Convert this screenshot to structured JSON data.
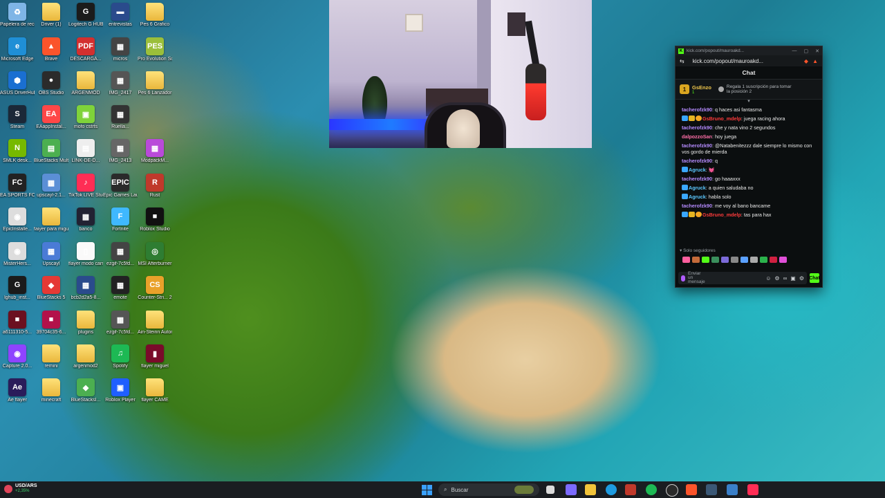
{
  "desktop": {
    "icons": [
      {
        "label": "Papelera de reciclaje",
        "glyph": "♻",
        "color": "#7fb5e6"
      },
      {
        "label": "Driver (1)",
        "glyph": "",
        "color": "folder"
      },
      {
        "label": "Logitech G HUB",
        "glyph": "G",
        "color": "#1b1b1b"
      },
      {
        "label": "entrevistas",
        "glyph": "▬",
        "color": "#2a4b8c"
      },
      {
        "label": "Pes 6 Grafico",
        "glyph": "",
        "color": "folder"
      },
      {
        "label": "Microsoft Edge",
        "glyph": "e",
        "color": "#1f8fd6"
      },
      {
        "label": "Brave",
        "glyph": "▲",
        "color": "#fb542b"
      },
      {
        "label": "DESCARGA...",
        "glyph": "PDF",
        "color": "#d32f2f"
      },
      {
        "label": "micros",
        "glyph": "▦",
        "color": "#444"
      },
      {
        "label": "Pro Evolution Soccer 6",
        "glyph": "PES",
        "color": "#9bbf3a"
      },
      {
        "label": "ASUS DriverHub",
        "glyph": "⬢",
        "color": "#1a6fd1"
      },
      {
        "label": "OBS Studio",
        "glyph": "●",
        "color": "#2b2b2b"
      },
      {
        "label": "ARGENMOD",
        "glyph": "",
        "color": "folder"
      },
      {
        "label": "IMG_2417",
        "glyph": "▦",
        "color": "#555"
      },
      {
        "label": "Pes 6 Lanzador",
        "glyph": "",
        "color": "folder"
      },
      {
        "label": "Steam",
        "glyph": "S",
        "color": "#1b2838"
      },
      {
        "label": "EAappInstal...",
        "glyph": "EA",
        "color": "#ff4747"
      },
      {
        "label": "mofo cstrts",
        "glyph": "▣",
        "color": "#7fd33a"
      },
      {
        "label": "Ruella...",
        "glyph": "▦",
        "color": "#333"
      },
      {
        "label": "",
        "glyph": "",
        "color": "none"
      },
      {
        "label": "SMLK desk...",
        "glyph": "N",
        "color": "#76b900"
      },
      {
        "label": "BlueStacks Multi-Insta...",
        "glyph": "▤",
        "color": "#4caf50"
      },
      {
        "label": "LINK-DE-D...",
        "glyph": "▤",
        "color": "#eeeeee"
      },
      {
        "label": "IMG_2413",
        "glyph": "▦",
        "color": "#666"
      },
      {
        "label": "ModpackM...",
        "glyph": "▦",
        "color": "#b94ad9"
      },
      {
        "label": "EA SPORTS FC 26",
        "glyph": "FC",
        "color": "#222"
      },
      {
        "label": "upscayl-2.1...",
        "glyph": "▦",
        "color": "#5b8fd6"
      },
      {
        "label": "TikTok LIVE Studio",
        "glyph": "♪",
        "color": "#ff2d55"
      },
      {
        "label": "Epic Games Launcher",
        "glyph": "EPIC",
        "color": "#2a2a2a"
      },
      {
        "label": "Rust",
        "glyph": "R",
        "color": "#c0392b"
      },
      {
        "label": "EpicInstalle...",
        "glyph": "◉",
        "color": "#ddd"
      },
      {
        "label": "faiyer para miguel",
        "glyph": "",
        "color": "folder"
      },
      {
        "label": "banco",
        "glyph": "▦",
        "color": "#223"
      },
      {
        "label": "Fortnite",
        "glyph": "F",
        "color": "#3fb8ff"
      },
      {
        "label": "Roblox Studio",
        "glyph": "■",
        "color": "#111"
      },
      {
        "label": "MisterHers...",
        "glyph": "◉",
        "color": "#ddd"
      },
      {
        "label": "Upscayl",
        "glyph": "▦",
        "color": "#4a7bd6"
      },
      {
        "label": "flayer modo carrera",
        "glyph": "▯",
        "color": "#fafafa"
      },
      {
        "label": "ezgif-7c5fd...",
        "glyph": "▦",
        "color": "#444"
      },
      {
        "label": "MSI Afterburner",
        "glyph": "◎",
        "color": "#2e7d32"
      },
      {
        "label": "lghub_inst...",
        "glyph": "G",
        "color": "#1b1b1b"
      },
      {
        "label": "BlueStacks 5",
        "glyph": "◆",
        "color": "#e53935"
      },
      {
        "label": "bcb2d2a5-8...",
        "glyph": "▦",
        "color": "#2a4b8c"
      },
      {
        "label": "emote",
        "glyph": "▦",
        "color": "#222"
      },
      {
        "label": "Counter-Stri... 2",
        "glyph": "CS",
        "color": "#e9a12a"
      },
      {
        "label": "a6111310-5...",
        "glyph": "■",
        "color": "#6b1020"
      },
      {
        "label": "39704c35-6...",
        "glyph": "■",
        "color": "#b3124a"
      },
      {
        "label": "plugins",
        "glyph": "",
        "color": "folder"
      },
      {
        "label": "ezgif-7c5fd...",
        "glyph": "▦",
        "color": "#555"
      },
      {
        "label": "Ain-Steinn Automatic",
        "glyph": "",
        "color": "folder"
      },
      {
        "label": "Capture 2.0...",
        "glyph": "◉",
        "color": "#8e44ff"
      },
      {
        "label": "remini",
        "glyph": "",
        "color": "folder"
      },
      {
        "label": "argenmod2",
        "glyph": "",
        "color": "folder"
      },
      {
        "label": "Spotify",
        "glyph": "♫",
        "color": "#1db954"
      },
      {
        "label": "flayer miguel",
        "glyph": "▮",
        "color": "#7a0b2a"
      },
      {
        "label": "Ae flayer",
        "glyph": "Ae",
        "color": "#2a1c5a"
      },
      {
        "label": "minecraft",
        "glyph": "",
        "color": "folder"
      },
      {
        "label": "BlueStacksI...",
        "glyph": "◆",
        "color": "#4caf50"
      },
      {
        "label": "Roblox Player",
        "glyph": "▣",
        "color": "#1f5fff"
      },
      {
        "label": "flayer CAME",
        "glyph": "",
        "color": "folder"
      }
    ]
  },
  "chat_window": {
    "title": "kick.com/popout/mauroakd...",
    "url": "kick.com/popout/mauroakd...",
    "header": "Chat",
    "pinned": {
      "user": "GsEnzo",
      "count": "1",
      "badge": "1",
      "desc": "Regala 1 suscripción para tomar la posición 2"
    },
    "messages": [
      {
        "user": "tacherofzk90",
        "color": "n-purple",
        "badges": [],
        "text": "q haces asi fantasma"
      },
      {
        "user": "GsBruno_mdelp",
        "color": "n-red",
        "badges": [
          "b-blue",
          "b-gold",
          "b-orange"
        ],
        "text": "juega racing ahora"
      },
      {
        "user": "tacherofzk90",
        "color": "n-purple",
        "badges": [],
        "text": "che y nata vino 2 segundos"
      },
      {
        "user": "dalpozzoSan",
        "color": "n-pink",
        "badges": [],
        "text": "hoy juega"
      },
      {
        "user": "tacherofzk90",
        "color": "n-purple",
        "badges": [],
        "text": "@Natabenitezzz dale siempre lo mismo con vos gordo de mierda"
      },
      {
        "user": "tacherofzk90",
        "color": "n-purple",
        "badges": [],
        "text": "q"
      },
      {
        "user": "Agruck",
        "color": "n-blue",
        "badges": [
          "b-blue"
        ],
        "text": "💓"
      },
      {
        "user": "tacherofzk90",
        "color": "n-purple",
        "badges": [],
        "text": "go haaaxxx"
      },
      {
        "user": "Agruck",
        "color": "n-blue",
        "badges": [
          "b-blue"
        ],
        "text": "a quien saludaba no"
      },
      {
        "user": "Agruck",
        "color": "n-blue",
        "badges": [
          "b-blue"
        ],
        "text": "habla solo"
      },
      {
        "user": "tacherofzk90",
        "color": "n-purple",
        "badges": [],
        "text": "me voy al bano bancame"
      },
      {
        "user": "GsBruno_mdelp",
        "color": "n-red",
        "badges": [
          "b-blue",
          "b-gold",
          "b-orange"
        ],
        "text": "tas para hax"
      }
    ],
    "followers_only": "Solo seguidores",
    "input_placeholder": "Enviar un mensaje",
    "send_label": "Chat"
  },
  "taskbar": {
    "ticker_pair": "USD/ARS",
    "ticker_change": "+2,35%",
    "search_placeholder": "Buscar"
  }
}
